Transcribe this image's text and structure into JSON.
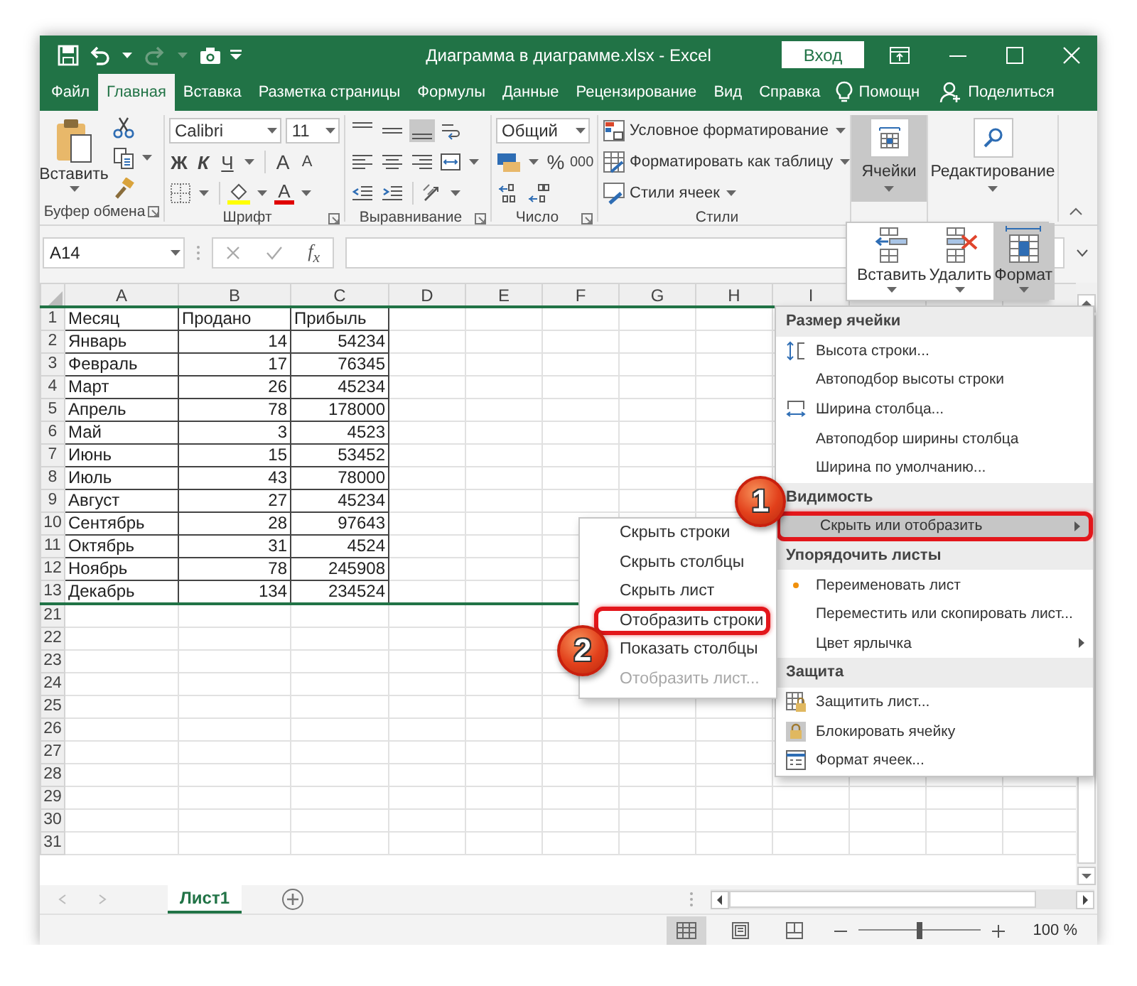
{
  "window": {
    "title": "Диаграмма в диаграмме.xlsx  -  Excel",
    "sign_in": "Вход"
  },
  "tabs": [
    {
      "label": "Файл",
      "selected": false
    },
    {
      "label": "Главная",
      "selected": true
    },
    {
      "label": "Вставка",
      "selected": false
    },
    {
      "label": "Разметка страницы",
      "selected": false
    },
    {
      "label": "Формулы",
      "selected": false
    },
    {
      "label": "Данные",
      "selected": false
    },
    {
      "label": "Рецензирование",
      "selected": false
    },
    {
      "label": "Вид",
      "selected": false
    },
    {
      "label": "Справка",
      "selected": false
    }
  ],
  "tell_me": "Помощн",
  "share": "Поделиться",
  "ribbon": {
    "clipboard": {
      "paste": "Вставить",
      "label": "Буфер обмена"
    },
    "font": {
      "name": "Calibri",
      "size": "11",
      "bold": "Ж",
      "italic": "К",
      "underline": "Ч",
      "grow_font": "A",
      "shrink_font": "A",
      "font_color": "A",
      "label": "Шрифт"
    },
    "alignment": {
      "label": "Выравнивание"
    },
    "number": {
      "format": "Общий",
      "percent": "%",
      "thousands": "000",
      "label": "Число"
    },
    "styles": {
      "items": [
        "Условное форматирование",
        "Форматировать как таблицу",
        "Стили ячеек"
      ],
      "label": "Стили"
    },
    "cells": {
      "label": "Ячейки",
      "selected": true
    },
    "editing": {
      "label": "Редактирование",
      "selected": false
    }
  },
  "formula_bar": {
    "name_box": "A14",
    "function_label": "f$_{x}$"
  },
  "columns": [
    "A",
    "B",
    "C",
    "D",
    "E",
    "F",
    "G",
    "H",
    "I"
  ],
  "rows": [
    {
      "number": "1",
      "kind": "header",
      "cells": [
        "Месяц",
        "Продано",
        "Прибыль"
      ],
      "hidden_below": false
    },
    {
      "number": "2",
      "kind": "data",
      "cells": [
        "Январь",
        "14",
        "54234"
      ],
      "hidden_below": false
    },
    {
      "number": "3",
      "kind": "data",
      "cells": [
        "Февраль",
        "17",
        "76345"
      ],
      "hidden_below": false
    },
    {
      "number": "4",
      "kind": "data",
      "cells": [
        "Март",
        "26",
        "45234"
      ],
      "hidden_below": false
    },
    {
      "number": "5",
      "kind": "data",
      "cells": [
        "Апрель",
        "78",
        "178000"
      ],
      "hidden_below": false
    },
    {
      "number": "6",
      "kind": "data",
      "cells": [
        "Май",
        "3",
        "4523"
      ],
      "hidden_below": false
    },
    {
      "number": "7",
      "kind": "data",
      "cells": [
        "Июнь",
        "15",
        "53452"
      ],
      "hidden_below": false
    },
    {
      "number": "8",
      "kind": "data",
      "cells": [
        "Июль",
        "43",
        "78000"
      ],
      "hidden_below": false
    },
    {
      "number": "9",
      "kind": "data",
      "cells": [
        "Август",
        "27",
        "45234"
      ],
      "hidden_below": false
    },
    {
      "number": "10",
      "kind": "data",
      "cells": [
        "Сентябрь",
        "28",
        "97643"
      ],
      "hidden_below": false
    },
    {
      "number": "11",
      "kind": "data",
      "cells": [
        "Октябрь",
        "31",
        "4524"
      ],
      "hidden_below": false
    },
    {
      "number": "12",
      "kind": "data",
      "cells": [
        "Ноябрь",
        "78",
        "245908"
      ],
      "hidden_below": false
    },
    {
      "number": "13",
      "kind": "data",
      "cells": [
        "Декабрь",
        "134",
        "234524"
      ],
      "hidden_below": true
    },
    {
      "number": "21",
      "hidden_below": false
    },
    {
      "number": "22",
      "hidden_below": false
    },
    {
      "number": "23",
      "hidden_below": false
    },
    {
      "number": "24",
      "hidden_below": false
    },
    {
      "number": "25",
      "hidden_below": false
    },
    {
      "number": "26",
      "hidden_below": false
    },
    {
      "number": "27",
      "hidden_below": false
    },
    {
      "number": "28",
      "hidden_below": false
    },
    {
      "number": "29",
      "hidden_below": false
    },
    {
      "number": "30",
      "hidden_below": false
    },
    {
      "number": "31",
      "hidden_below": false
    }
  ],
  "cells_dropdown": {
    "items": [
      {
        "label": "Вставить",
        "kind": "insert",
        "selected": false
      },
      {
        "label": "Удалить",
        "kind": "delete",
        "selected": false
      },
      {
        "label": "Формат",
        "kind": "format",
        "selected": true
      }
    ]
  },
  "format_menu": {
    "sections": [
      {
        "heading": "Размер ячейки",
        "items": [
          {
            "label": "Высота строки...",
            "kind": "row-height",
            "has_submenu": false,
            "highlighted": false,
            "marked": false
          },
          {
            "label": "Автоподбор высоты строки",
            "kind": "plain",
            "has_submenu": false,
            "highlighted": false,
            "marked": false
          },
          {
            "label": "Ширина столбца...",
            "kind": "column-width",
            "has_submenu": false,
            "highlighted": false,
            "marked": false
          },
          {
            "label": "Автоподбор ширины столбца",
            "kind": "plain",
            "has_submenu": false,
            "highlighted": false,
            "marked": false
          },
          {
            "label": "Ширина по умолчанию...",
            "kind": "plain",
            "has_submenu": false,
            "highlighted": false,
            "marked": false
          }
        ]
      },
      {
        "heading": "Видимость",
        "items": [
          {
            "label": "Скрыть или отобразить",
            "kind": "plain",
            "has_submenu": true,
            "highlighted": true,
            "marked": true
          }
        ]
      },
      {
        "heading": "Упорядочить листы",
        "items": [
          {
            "label": "Переименовать лист",
            "kind": "bullet",
            "has_submenu": false,
            "highlighted": false,
            "marked": false
          },
          {
            "label": "Переместить или скопировать лист...",
            "kind": "plain",
            "has_submenu": false,
            "highlighted": false,
            "marked": false
          },
          {
            "label": "Цвет ярлычка",
            "kind": "plain",
            "has_submenu": true,
            "highlighted": false,
            "marked": false
          }
        ]
      },
      {
        "heading": "Защита",
        "items": [
          {
            "label": "Защитить лист...",
            "kind": "protect-sheet",
            "has_submenu": false,
            "highlighted": false,
            "marked": false
          },
          {
            "label": "Блокировать ячейку",
            "kind": "lock",
            "has_submenu": false,
            "highlighted": false,
            "marked": false
          },
          {
            "label": "Формат ячеек...",
            "kind": "format-cells",
            "has_submenu": false,
            "highlighted": false,
            "marked": false
          }
        ]
      }
    ]
  },
  "submenu": {
    "items": [
      {
        "label": "Скрыть строки",
        "disabled": false,
        "marked": false
      },
      {
        "label": "Скрыть столбцы",
        "disabled": false,
        "marked": false
      },
      {
        "label": "Скрыть лист",
        "disabled": false,
        "marked": false
      },
      {
        "label": "Отобразить строки",
        "disabled": false,
        "marked": true
      },
      {
        "label": "Показать столбцы",
        "disabled": false,
        "marked": false
      },
      {
        "label": "Отобразить лист...",
        "disabled": true,
        "marked": false
      }
    ]
  },
  "callouts": [
    {
      "number": "1"
    },
    {
      "number": "2"
    }
  ],
  "sheet_tabs": [
    {
      "label": "Лист1",
      "selected": true
    }
  ],
  "status_bar": {
    "views": [
      {
        "kind": "normal",
        "selected": true
      },
      {
        "kind": "page-layout",
        "selected": false
      },
      {
        "kind": "page-break",
        "selected": false
      }
    ],
    "zoom": {
      "level": 0.5,
      "reading": "100 %"
    }
  }
}
